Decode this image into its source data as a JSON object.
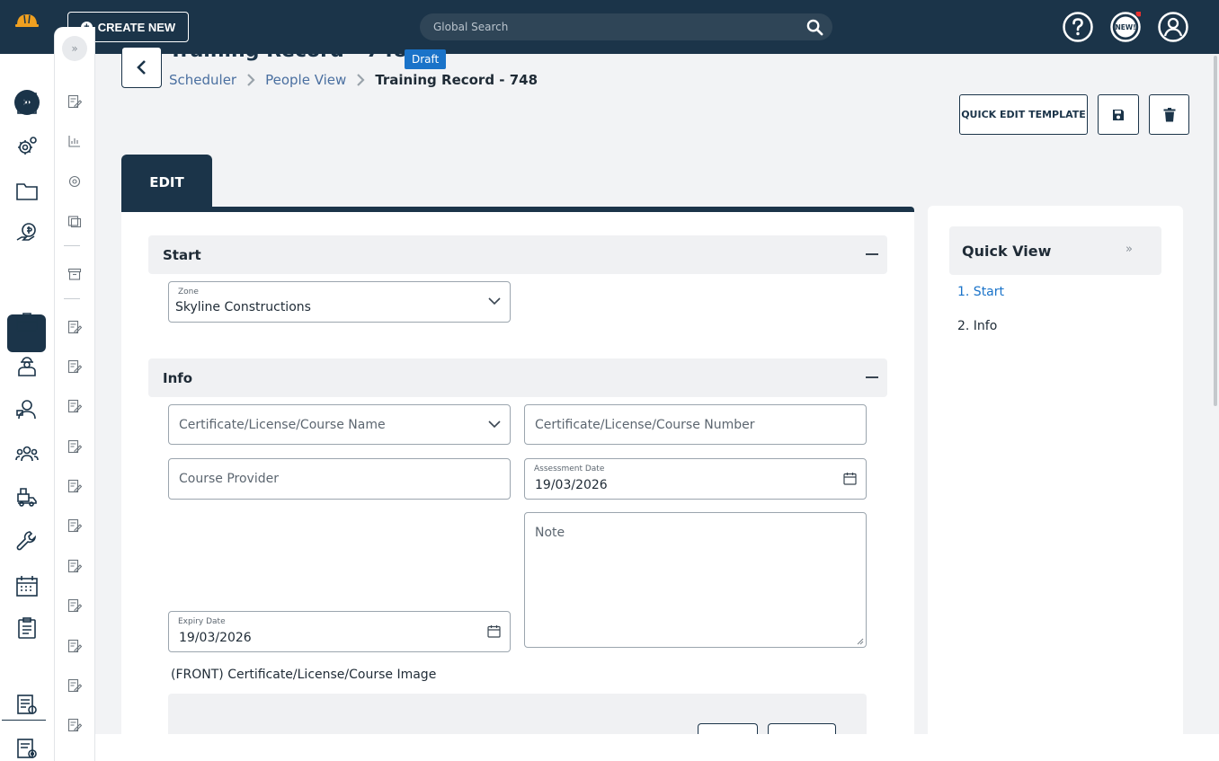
{
  "topbar": {
    "create_label": "CREATE NEW",
    "search_placeholder": "Global Search",
    "new_badge": "NEW!"
  },
  "header": {
    "title": "Training Record - 748",
    "status": "Draft",
    "breadcrumbs": [
      "Scheduler",
      "People View",
      "Training Record - 748"
    ],
    "quick_edit_label": "QUICK EDIT TEMPLATE"
  },
  "tabs": [
    {
      "label": "EDIT"
    }
  ],
  "sections": {
    "start": {
      "label": "Start"
    },
    "info": {
      "label": "Info"
    }
  },
  "fields": {
    "zone": {
      "label": "Zone",
      "value": "Skyline Constructions"
    },
    "cert_name": {
      "placeholder": "Certificate/License/Course Name"
    },
    "cert_number": {
      "placeholder": "Certificate/License/Course Number"
    },
    "course_provider": {
      "placeholder": "Course Provider"
    },
    "assessment_date": {
      "label": "Assessment Date",
      "value": "19/03/2026"
    },
    "note": {
      "placeholder": "Note"
    },
    "expiry_date": {
      "label": "Expiry Date",
      "value": "19/03/2026"
    },
    "front_image": {
      "label": "(FRONT) Certificate/License/Course Image"
    }
  },
  "quick_view": {
    "title": "Quick View",
    "items": [
      "1. Start",
      "2. Info"
    ]
  },
  "colors": {
    "primary": "#1b3449",
    "accent": "#1a73c9",
    "link": "#4a6fa0",
    "badge": "#e8312f",
    "logo": "#f0a020"
  }
}
